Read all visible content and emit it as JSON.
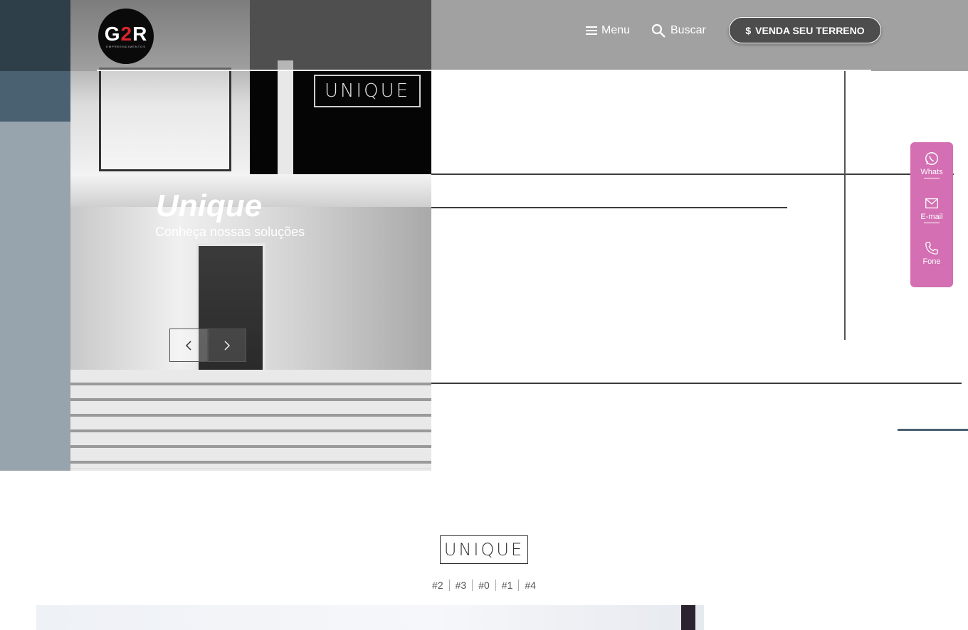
{
  "logo": {
    "mark_left": "G",
    "mark_mid": "2",
    "mark_right": "R",
    "subtitle": "EMPREENDIMENTOS"
  },
  "header": {
    "menu_label": "Menu",
    "search_label": "Buscar",
    "cta_label": "VENDA SEU TERRENO",
    "cta_icon": "$"
  },
  "hero": {
    "badge": "UNIQUE",
    "title": "Unique",
    "subtitle": "Conheça nossas soluções",
    "prev_icon": "chevron-left-icon",
    "next_icon": "chevron-right-icon"
  },
  "contact": {
    "items": [
      {
        "label": "Whats",
        "icon": "whatsapp-icon"
      },
      {
        "label": "E-mail",
        "icon": "mail-icon"
      },
      {
        "label": "Fone",
        "icon": "phone-icon"
      }
    ],
    "color": "#d36fb2"
  },
  "section": {
    "title": "UNIQUE",
    "tags": [
      "#2",
      "#3",
      "#0",
      "#1",
      "#4"
    ]
  }
}
